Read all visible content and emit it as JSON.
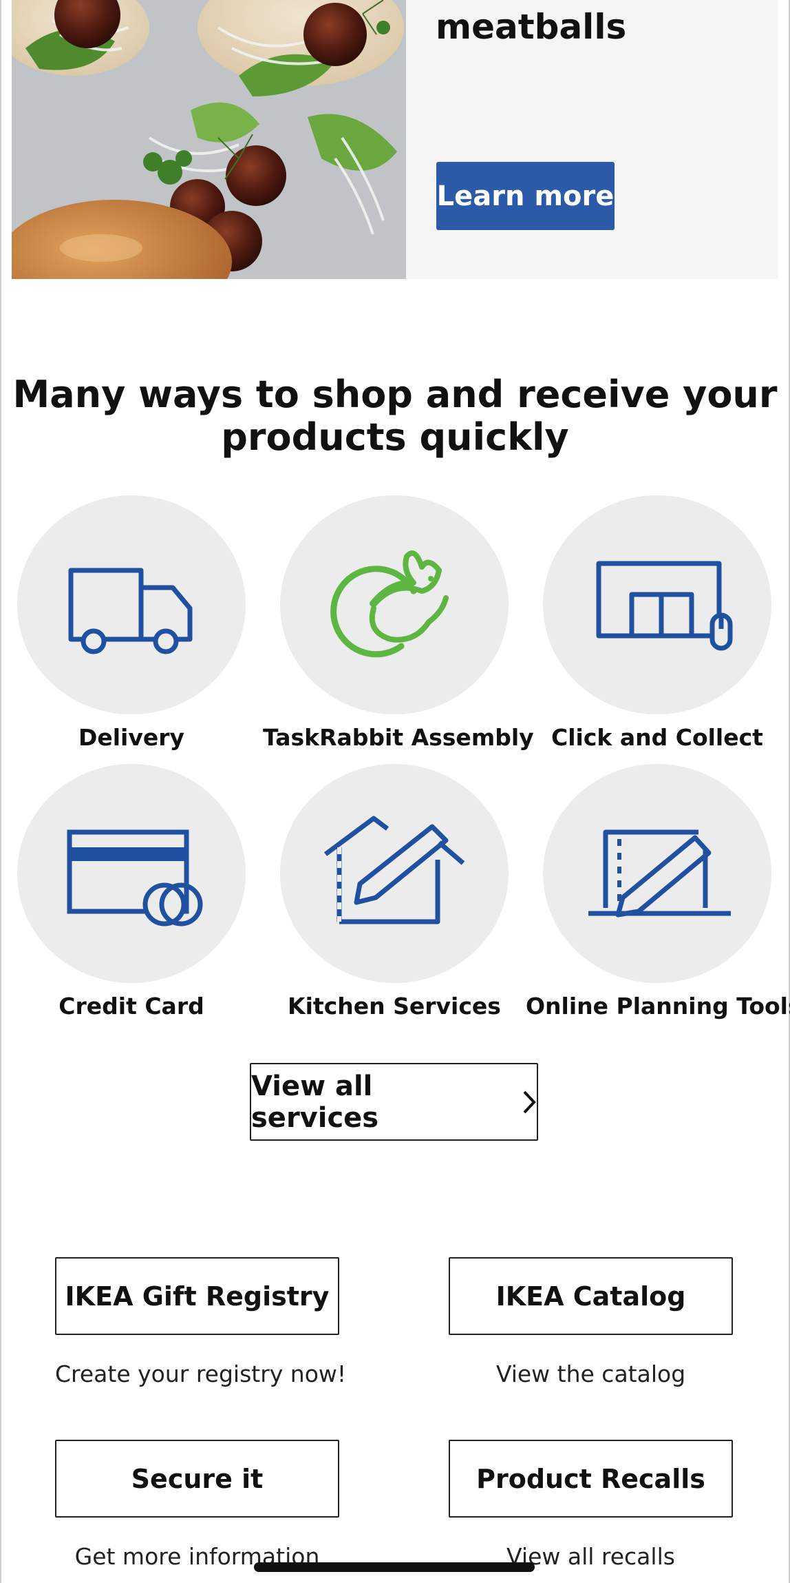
{
  "hero": {
    "title": "meatballs",
    "button_label": "Learn more"
  },
  "section": {
    "title_line1": "Many ways to shop and receive your",
    "title_line2": "products quickly"
  },
  "services": [
    {
      "label": "Delivery",
      "icon": "truck-icon"
    },
    {
      "label": "TaskRabbit Assembly",
      "icon": "taskrabbit-icon"
    },
    {
      "label": "Click and Collect",
      "icon": "click-collect-icon"
    },
    {
      "label": "Credit Card",
      "icon": "credit-card-icon"
    },
    {
      "label": "Kitchen Services",
      "icon": "kitchen-pencil-icon"
    },
    {
      "label": "Online Planning Tools",
      "icon": "planning-tools-icon"
    }
  ],
  "all_services_label": "View all services",
  "links": [
    {
      "label": "IKEA Gift Registry",
      "sub": "Create your registry now!"
    },
    {
      "label": "IKEA Catalog",
      "sub": "View the catalog"
    },
    {
      "label": "Secure it",
      "sub": "Get more information"
    },
    {
      "label": "Product Recalls",
      "sub": "View all recalls"
    }
  ],
  "colors": {
    "brand_blue": "#2a5aa8",
    "icon_blue": "#2050a0",
    "taskrabbit_green": "#5db542",
    "circle_gray": "#ececec",
    "hero_bg": "#f5f5f5"
  }
}
